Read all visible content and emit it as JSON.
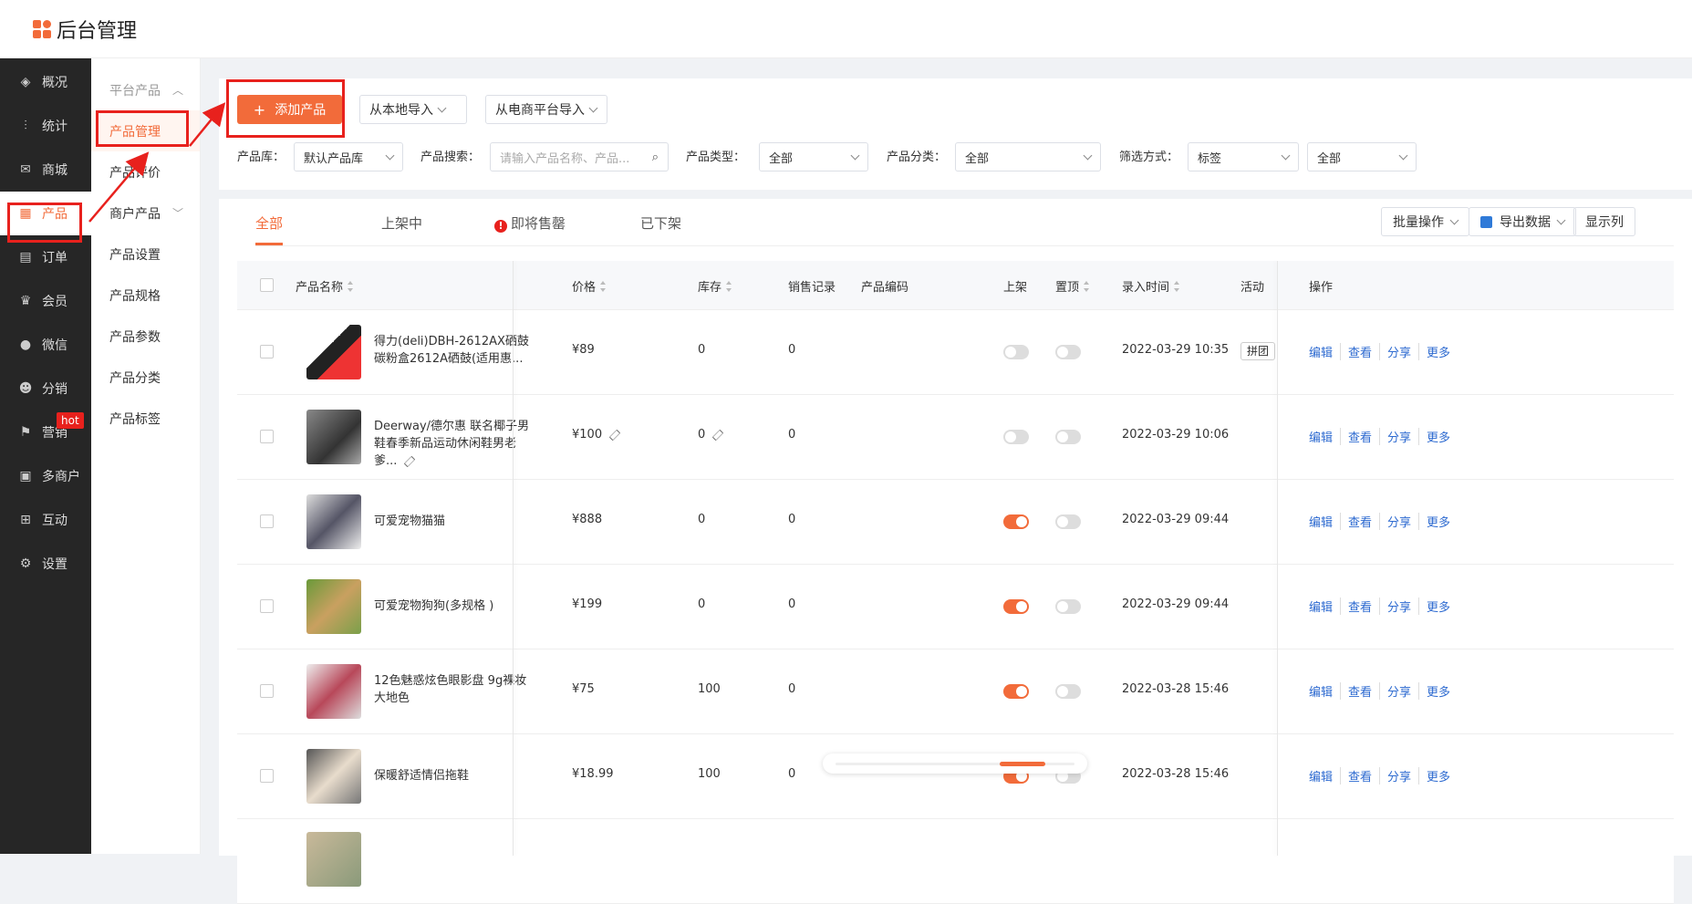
{
  "app": {
    "title": "后台管理"
  },
  "sidebar": {
    "items": [
      {
        "label": "概况",
        "icon": "layers-icon"
      },
      {
        "label": "统计",
        "icon": "chart-icon"
      },
      {
        "label": "商城",
        "icon": "mail-icon"
      },
      {
        "label": "产品",
        "icon": "grid-icon"
      },
      {
        "label": "订单",
        "icon": "clipboard-icon"
      },
      {
        "label": "会员",
        "icon": "crown-icon"
      },
      {
        "label": "微信",
        "icon": "wechat-icon"
      },
      {
        "label": "分销",
        "icon": "users-icon"
      },
      {
        "label": "营销",
        "icon": "flag-icon",
        "badge": "hot"
      },
      {
        "label": "多商户",
        "icon": "store-icon"
      },
      {
        "label": "互动",
        "icon": "apps-icon"
      },
      {
        "label": "设置",
        "icon": "gear-icon"
      }
    ]
  },
  "subnav": {
    "group1": "平台产品",
    "items1": [
      "产品管理",
      "产品评价"
    ],
    "group2": "商户产品",
    "items2": [
      "产品设置",
      "产品规格",
      "产品参数",
      "产品分类",
      "产品标签"
    ]
  },
  "toolbar": {
    "add_label": "添加产品",
    "import_local": "从本地导入",
    "import_platform": "从电商平台导入",
    "filters": {
      "lib_label": "产品库：",
      "lib_value": "默认产品库",
      "search_label": "产品搜索：",
      "search_placeholder": "请输入产品名称、产品...",
      "type_label": "产品类型：",
      "type_value": "全部",
      "cat_label": "产品分类：",
      "cat_value": "全部",
      "mode_label": "筛选方式：",
      "mode_value": "标签",
      "mode_value2": "全部"
    }
  },
  "tabs": [
    "全部",
    "上架中",
    "即将售罄",
    "已下架"
  ],
  "actions": {
    "batch": "批量操作",
    "export": "导出数据",
    "columns": "显示列"
  },
  "columns": [
    "产品名称",
    "价格",
    "库存",
    "销售记录",
    "产品编码",
    "上架",
    "置顶",
    "录入时间",
    "活动",
    "操作"
  ],
  "rows": [
    {
      "name": "得力(deli)DBH-2612AX硒鼓 碳粉盒2612A硒鼓(适用惠...",
      "price": "¥89",
      "stock": "0",
      "sales": "0",
      "on": false,
      "top": false,
      "time": "2022-03-29 10:35",
      "activity": "拼团"
    },
    {
      "name": "Deerway/德尔惠 联名椰子男鞋春季新品运动休闲鞋男老爹...",
      "price": "¥100",
      "stock": "0",
      "sales": "0",
      "on": false,
      "top": false,
      "time": "2022-03-29 10:06",
      "activity": ""
    },
    {
      "name": "可爱宠物猫猫",
      "price": "¥888",
      "stock": "0",
      "sales": "0",
      "on": true,
      "top": false,
      "time": "2022-03-29 09:44",
      "activity": ""
    },
    {
      "name": "可爱宠物狗狗(多规格 )",
      "price": "¥199",
      "stock": "0",
      "sales": "0",
      "on": true,
      "top": false,
      "time": "2022-03-29 09:44",
      "activity": ""
    },
    {
      "name": "12色魅惑炫色眼影盘 9g裸妆大地色",
      "price": "¥75",
      "stock": "100",
      "sales": "0",
      "on": true,
      "top": false,
      "time": "2022-03-28 15:46",
      "activity": ""
    },
    {
      "name": "保暖舒适情侣拖鞋",
      "price": "¥18.99",
      "stock": "100",
      "sales": "0",
      "on": true,
      "top": false,
      "time": "2022-03-28 15:46",
      "activity": ""
    }
  ],
  "ops": [
    "编辑",
    "查看",
    "分享",
    "更多"
  ],
  "colors": {
    "accent": "#f26b3a",
    "annotation": "#e8211d",
    "link": "#2d6ad0"
  }
}
